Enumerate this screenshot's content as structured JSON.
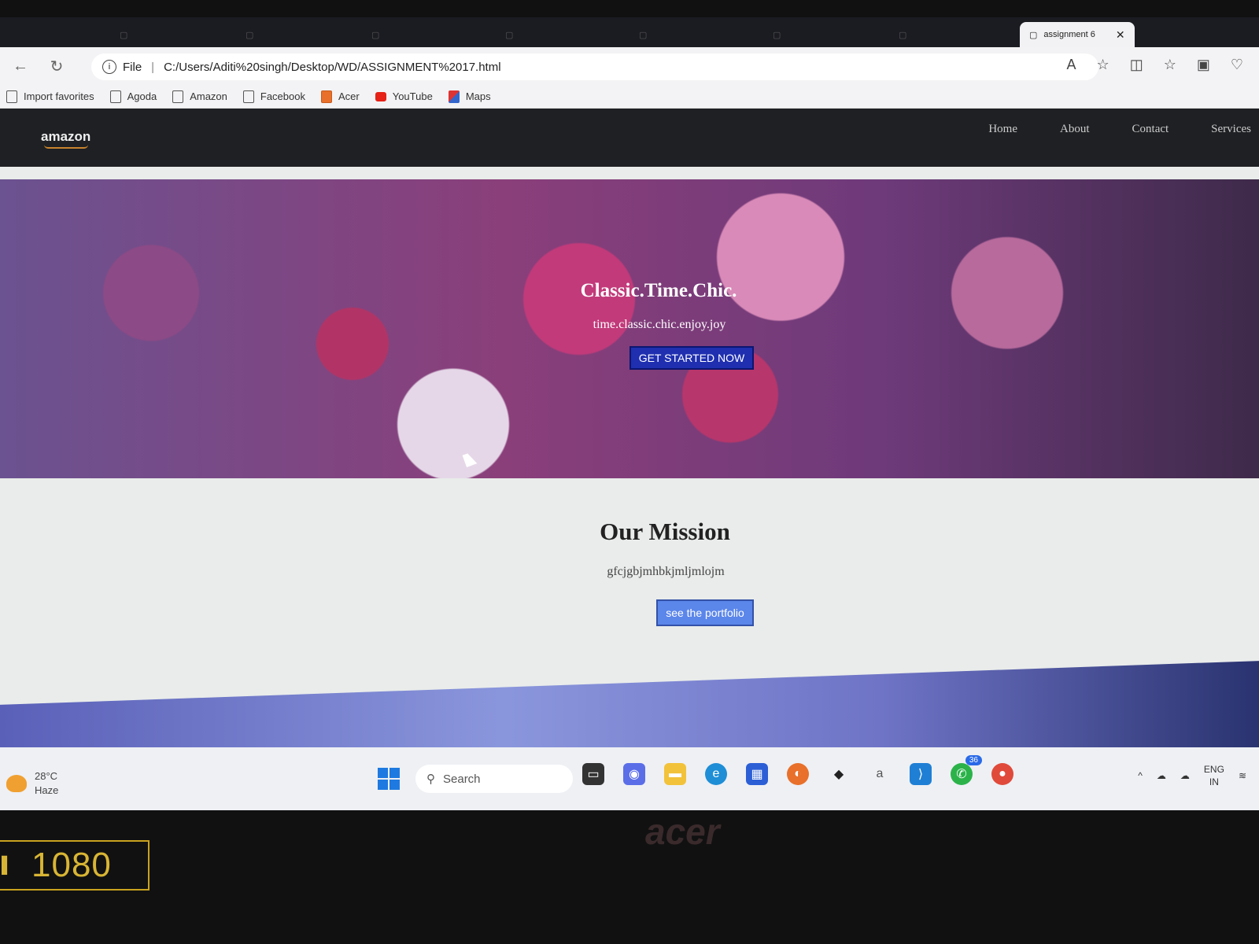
{
  "browser": {
    "active_tab": {
      "title": "assignment 6"
    },
    "address": {
      "scheme_label": "File",
      "url": "C:/Users/Aditi%20singh/Desktop/WD/ASSIGNMENT%2017.html"
    },
    "bookmarks": [
      {
        "label": "Import favorites",
        "icon": "import-icon"
      },
      {
        "label": "Agoda",
        "icon": "page-icon"
      },
      {
        "label": "Amazon",
        "icon": "page-icon"
      },
      {
        "label": "Facebook",
        "icon": "page-icon"
      },
      {
        "label": "Acer",
        "icon": "folder-icon"
      },
      {
        "label": "YouTube",
        "icon": "youtube-icon"
      },
      {
        "label": "Maps",
        "icon": "maps-icon"
      }
    ]
  },
  "site": {
    "logo": "amazon",
    "menu": [
      "Home",
      "About",
      "Contact",
      "Services"
    ],
    "hero": {
      "title": "Classic.Time.Chic.",
      "subtitle": "time.classic.chic.enjoy.joy",
      "cta": "GET STARTED NOW"
    },
    "mission": {
      "title": "Our Mission",
      "text": "gfcjgbjmhbkjmljmlojm",
      "cta": "see the portfolio"
    }
  },
  "taskbar": {
    "weather": {
      "temp": "28°C",
      "condition": "Haze"
    },
    "search_placeholder": "Search",
    "whatsapp_badge": "36",
    "language": {
      "line1": "ENG",
      "line2": "IN"
    }
  },
  "overlay": {
    "resolution": "1080"
  },
  "colors": {
    "hero_button": "#1f2fb0",
    "mission_button": "#5b86ea",
    "nav_bg": "#1e2023"
  }
}
